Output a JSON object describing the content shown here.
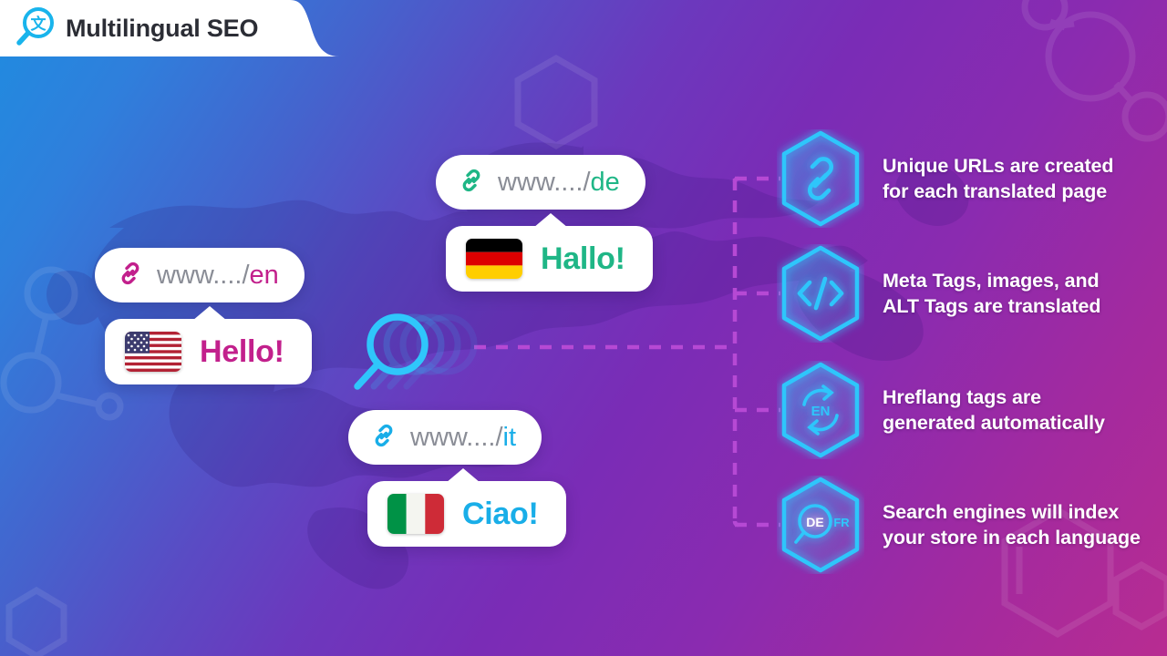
{
  "header": {
    "title": "Multilingual SEO",
    "logo_icon": "magnifier-translate-icon",
    "logo_glyph": "文"
  },
  "colors": {
    "accent_cyan": "#19b4ec",
    "accent_magenta": "#c2208c",
    "accent_green": "#1fb686",
    "bg_blue": "#1f8ce0",
    "bg_purple": "#7a2cb6",
    "bg_magenta": "#b82c91",
    "url_gray": "#8a8d96",
    "dash_line": "#b649d4",
    "card_white": "#ffffff"
  },
  "center": {
    "icon": "search-magnifier-icon"
  },
  "languages": [
    {
      "code": "en",
      "url_prefix": "www..../",
      "url_locale": "en",
      "greeting": "Hello!",
      "flag": "us-flag",
      "flag_alt": "United States flag",
      "color": "#c2208c",
      "link_icon": "link-chain-icon"
    },
    {
      "code": "de",
      "url_prefix": "www..../",
      "url_locale": "de",
      "greeting": "Hallo!",
      "flag": "de-flag",
      "flag_alt": "Germany flag",
      "color": "#1fb686",
      "link_icon": "link-chain-icon"
    },
    {
      "code": "it",
      "url_prefix": "www..../",
      "url_locale": "it",
      "greeting": "Ciao!",
      "flag": "it-flag",
      "flag_alt": "Italy flag",
      "color": "#19aee8",
      "link_icon": "link-chain-icon"
    }
  ],
  "features": [
    {
      "icon": "link-chain-icon",
      "line1": "Unique URLs are created",
      "line2": "for each translated page"
    },
    {
      "icon": "code-brackets-icon",
      "line1": "Meta Tags, images, and",
      "line2": "ALT Tags are translated"
    },
    {
      "icon": "hreflang-sync-icon",
      "icon_label": "EN",
      "line1": "Hreflang tags are",
      "line2": "generated automatically"
    },
    {
      "icon": "search-language-index-icon",
      "icon_label_primary": "DE",
      "icon_label_secondary": "FR",
      "line1": "Search engines will index",
      "line2": "your store in each language"
    }
  ]
}
